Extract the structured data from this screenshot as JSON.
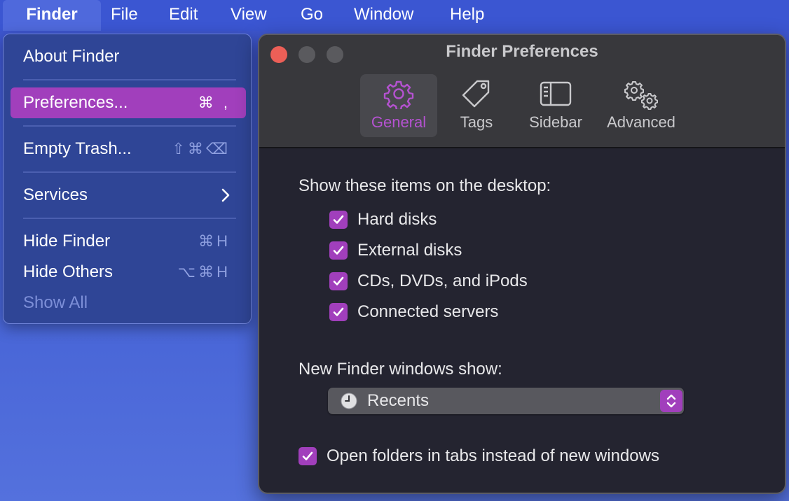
{
  "menubar": {
    "app": "Finder",
    "items": [
      "File",
      "Edit",
      "View",
      "Go",
      "Window",
      "Help"
    ]
  },
  "menu": {
    "about": "About Finder",
    "preferences": "Preferences...",
    "preferences_shortcut": "⌘ ,",
    "empty_trash": "Empty Trash...",
    "empty_trash_shortcut": "⇧⌘⌫",
    "services": "Services",
    "hide_finder": "Hide Finder",
    "hide_finder_shortcut": "⌘H",
    "hide_others": "Hide Others",
    "hide_others_shortcut": "⌥⌘H",
    "show_all": "Show All"
  },
  "window": {
    "title": "Finder Preferences",
    "tabs": {
      "general": "General",
      "tags": "Tags",
      "sidebar": "Sidebar",
      "advanced": "Advanced"
    },
    "active_tab": "General",
    "desktop_section": "Show these items on the desktop:",
    "desktop_items": [
      {
        "label": "Hard disks",
        "checked": true
      },
      {
        "label": "External disks",
        "checked": true
      },
      {
        "label": "CDs, DVDs, and iPods",
        "checked": true
      },
      {
        "label": "Connected servers",
        "checked": true
      }
    ],
    "new_window_label": "New Finder windows show:",
    "new_window_value": "Recents",
    "open_in_tabs": {
      "label": "Open folders in tabs instead of new windows",
      "checked": true
    }
  },
  "colors": {
    "accent": "#a13fbc",
    "menubar": "#3b56d2",
    "menu_bg": "#2f4596",
    "window_bg": "#242430",
    "toolbar_bg": "#38383c",
    "close_button": "#ec5f57"
  },
  "icons": [
    "gear-icon",
    "tag-icon",
    "sidebar-icon",
    "gears-icon",
    "clock-icon",
    "chevron-right-icon",
    "checkmark-icon",
    "up-down-arrows-icon"
  ]
}
